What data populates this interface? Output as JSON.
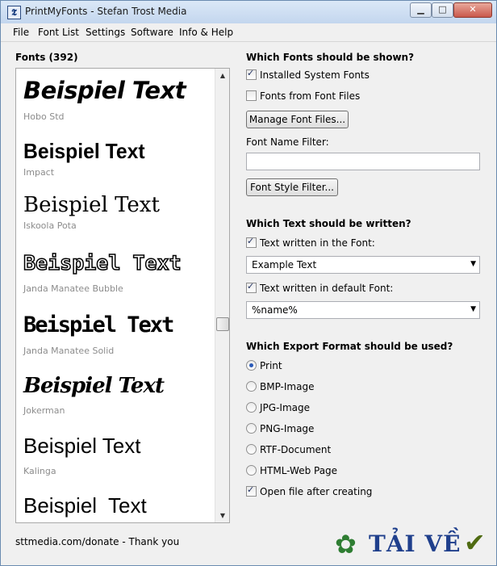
{
  "window": {
    "title": "PrintMyFonts - Stefan Trost Media",
    "app_icon": "𝕿",
    "min_icon": "▁",
    "max_icon": "□",
    "close_icon": "✕"
  },
  "menu": [
    "File",
    "Font List",
    "Settings",
    "Software",
    "Info & Help"
  ],
  "fonts_panel": {
    "header": "Fonts (392)",
    "items": [
      {
        "sample": "Beispiel Text",
        "name": "Hobo Std"
      },
      {
        "sample": "Beispiel Text",
        "name": "Impact"
      },
      {
        "sample": "Beispiel Text",
        "name": "Iskoola Pota"
      },
      {
        "sample": "Beispiel Text",
        "name": "Janda Manatee Bubble"
      },
      {
        "sample": "Beispiel Text",
        "name": "Janda Manatee Solid"
      },
      {
        "sample": "Beispiel Text",
        "name": "Jokerman"
      },
      {
        "sample": "Beispiel Text",
        "name": "Kalinga"
      },
      {
        "sample": "Beispiel  Text",
        "name": ""
      }
    ],
    "scroll_up_icon": "▲",
    "scroll_down_icon": "▼"
  },
  "shown": {
    "title": "Which Fonts should be shown?",
    "installed_label": "Installed System Fonts",
    "installed_checked": true,
    "files_label": "Fonts from Font Files",
    "files_checked": false,
    "manage_button": "Manage Font Files...",
    "filter_label": "Font Name Filter:",
    "filter_value": "",
    "style_button": "Font Style Filter..."
  },
  "text": {
    "title": "Which Text should be written?",
    "in_font_label": "Text written in the Font:",
    "in_font_checked": true,
    "in_font_value": "Example Text",
    "default_label": "Text written in default Font:",
    "default_checked": true,
    "default_value": "%name%"
  },
  "export": {
    "title": "Which Export Format should be used?",
    "options": [
      "Print",
      "BMP-Image",
      "JPG-Image",
      "PNG-Image",
      "RTF-Document",
      "HTML-Web Page"
    ],
    "selected": "Print",
    "open_after_label": "Open file after creating",
    "open_after_checked": true
  },
  "footer": {
    "text": "sttmedia.com/donate - Thank you"
  },
  "watermark": {
    "text": "TẢI VỀ",
    "clover_icon": "✿",
    "check_icon": "✔"
  },
  "colors": {
    "title_bar": "#c3d6ee",
    "close_button": "#c9584b",
    "font_name_gray": "#8c8c8c",
    "watermark_text": "#1f3f8c",
    "watermark_clover": "#2e7d32",
    "watermark_check": "#4f6b12"
  }
}
